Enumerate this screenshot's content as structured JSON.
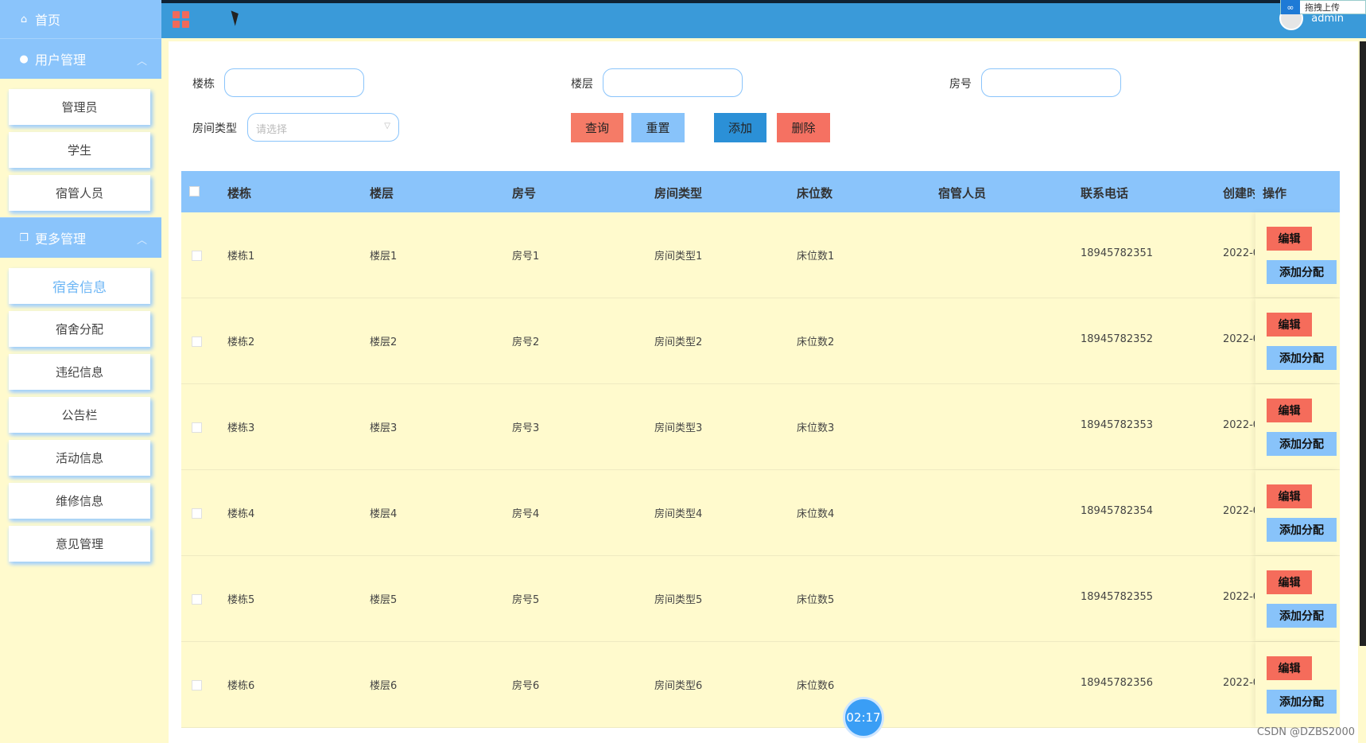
{
  "sidebar": {
    "home_label": "首页",
    "user_group_label": "用户管理",
    "user_items": [
      "管理员",
      "学生",
      "宿管人员"
    ],
    "more_group_label": "更多管理",
    "more_items": [
      "宿舍信息",
      "宿舍分配",
      "违纪信息",
      "公告栏",
      "活动信息",
      "维修信息",
      "意见管理"
    ],
    "active_item": "宿舍信息"
  },
  "topbar": {
    "username": "admin",
    "upload_label": "拖拽上传"
  },
  "search": {
    "building_label": "楼栋",
    "floor_label": "楼层",
    "room_label": "房号",
    "room_type_label": "房间类型",
    "room_type_placeholder": "请选择",
    "btn_search": "查询",
    "btn_reset": "重置",
    "btn_add": "添加",
    "btn_delete": "删除"
  },
  "table": {
    "headers": [
      "楼栋",
      "楼层",
      "房号",
      "房间类型",
      "床位数",
      "宿管人员",
      "联系电话",
      "创建时",
      "操作"
    ],
    "rows": [
      {
        "building": "楼栋1",
        "floor": "楼层1",
        "room": "房号1",
        "type": "房间类型1",
        "beds": "床位数1",
        "manager": "",
        "phone": "18945782351",
        "created": "2022-0"
      },
      {
        "building": "楼栋2",
        "floor": "楼层2",
        "room": "房号2",
        "type": "房间类型2",
        "beds": "床位数2",
        "manager": "",
        "phone": "18945782352",
        "created": "2022-0"
      },
      {
        "building": "楼栋3",
        "floor": "楼层3",
        "room": "房号3",
        "type": "房间类型3",
        "beds": "床位数3",
        "manager": "",
        "phone": "18945782353",
        "created": "2022-0"
      },
      {
        "building": "楼栋4",
        "floor": "楼层4",
        "room": "房号4",
        "type": "房间类型4",
        "beds": "床位数4",
        "manager": "",
        "phone": "18945782354",
        "created": "2022-0"
      },
      {
        "building": "楼栋5",
        "floor": "楼层5",
        "room": "房号5",
        "type": "房间类型5",
        "beds": "床位数5",
        "manager": "",
        "phone": "18945782355",
        "created": "2022-0"
      },
      {
        "building": "楼栋6",
        "floor": "楼层6",
        "room": "房号6",
        "type": "房间类型6",
        "beds": "床位数6",
        "manager": "",
        "phone": "18945782356",
        "created": "2022-0"
      }
    ],
    "edit_label": "编辑",
    "assign_label": "添加分配"
  },
  "overlay": {
    "timer": "02:17",
    "watermark": "CSDN @DZBS2000"
  },
  "colors": {
    "accent_blue": "#8ac4fb",
    "topbar_blue": "#3a9ad9",
    "danger_red": "#f56c5b",
    "row_bg": "#fffacd"
  }
}
